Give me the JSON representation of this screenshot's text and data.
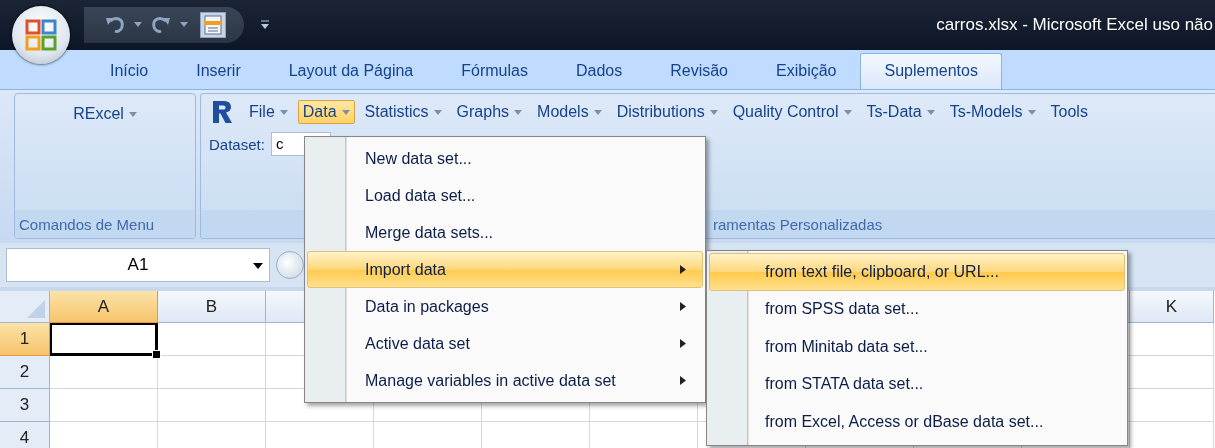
{
  "window": {
    "title": "carros.xlsx - Microsoft Excel uso não"
  },
  "tabs": [
    {
      "label": "Início",
      "selected": false
    },
    {
      "label": "Inserir",
      "selected": false
    },
    {
      "label": "Layout da Página",
      "selected": false
    },
    {
      "label": "Fórmulas",
      "selected": false
    },
    {
      "label": "Dados",
      "selected": false
    },
    {
      "label": "Revisão",
      "selected": false
    },
    {
      "label": "Exibição",
      "selected": false
    },
    {
      "label": "Suplementos",
      "selected": true
    }
  ],
  "ribbon": {
    "groups": [
      {
        "kind": "buttons",
        "buttons": [
          {
            "label": "RExcel",
            "dropdown": true
          }
        ],
        "label": "Comandos de Menu"
      },
      {
        "kind": "menubar",
        "menus": [
          {
            "label": "File",
            "dropdown": true,
            "selected": false
          },
          {
            "label": "Data",
            "dropdown": true,
            "selected": true
          },
          {
            "label": "Statistics",
            "dropdown": true,
            "selected": false
          },
          {
            "label": "Graphs",
            "dropdown": true,
            "selected": false
          },
          {
            "label": "Models",
            "dropdown": true,
            "selected": false
          },
          {
            "label": "Distributions",
            "dropdown": true,
            "selected": false
          },
          {
            "label": "Quality Control",
            "dropdown": true,
            "selected": false
          },
          {
            "label": "Ts-Data",
            "dropdown": true,
            "selected": false
          },
          {
            "label": "Ts-Models",
            "dropdown": true,
            "selected": false
          },
          {
            "label": "Tools",
            "dropdown": false,
            "selected": false
          }
        ],
        "dataset": {
          "label": "Dataset:",
          "value": "c"
        },
        "label": "ramentas Personalizadas"
      }
    ]
  },
  "name_box": {
    "value": "A1"
  },
  "sheet": {
    "columns": [
      {
        "label": "A",
        "selected": true
      },
      {
        "label": "B",
        "selected": false
      },
      {
        "label": "K",
        "selected": false
      }
    ],
    "rows": [
      {
        "label": "1",
        "selected": true
      },
      {
        "label": "2",
        "selected": false
      },
      {
        "label": "3",
        "selected": false
      },
      {
        "label": "4",
        "selected": false
      }
    ]
  },
  "menu": {
    "items": [
      {
        "label": "New data set...",
        "submenu": false,
        "selected": false
      },
      {
        "label": "Load data set...",
        "submenu": false,
        "selected": false
      },
      {
        "label": "Merge data sets...",
        "submenu": false,
        "selected": false
      },
      {
        "label": "Import data",
        "submenu": true,
        "selected": true
      },
      {
        "label": "Data in packages",
        "submenu": true,
        "selected": false
      },
      {
        "label": "Active data set",
        "submenu": true,
        "selected": false
      },
      {
        "label": "Manage variables in active data set",
        "submenu": true,
        "selected": false
      }
    ]
  },
  "submenu": {
    "items": [
      {
        "label": "from text file, clipboard, or URL...",
        "selected": true
      },
      {
        "label": "from SPSS data set...",
        "selected": false
      },
      {
        "label": "from Minitab data set...",
        "selected": false
      },
      {
        "label": "from STATA data set...",
        "selected": false
      },
      {
        "label": "from Excel, Access or dBase data set...",
        "selected": false
      }
    ]
  }
}
